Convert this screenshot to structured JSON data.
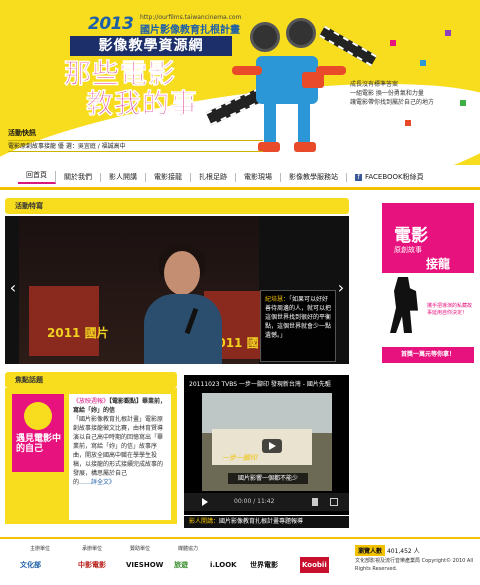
{
  "header": {
    "year": "2013",
    "url": "http://ourfilms.taiwancinema.com",
    "plan": "國片影像教育扎根計畫",
    "site_name": "影像教學資源網",
    "big_title_line1": "那些電影",
    "big_title_line2": "教我的事",
    "slogan": [
      "成長沒有標準答案",
      "一組電影 換一份勇氣和力量",
      "讓電影帶你找到屬於自己的地方"
    ],
    "news_label": "活動快訊",
    "news_text": "電影原創故事接龍 優 選：吳宜庭 / 福誠高中"
  },
  "nav": {
    "items": [
      "回首頁",
      "關於我們",
      "影人開講",
      "電影接龍",
      "扎根足跡",
      "電影現場",
      "影像教學服務站",
      "FACEBOOK粉絲頁"
    ]
  },
  "feature": {
    "heading": "活動特寫",
    "banner_left": "2011 國片",
    "banner_right": "2011 國片",
    "caption_name": "紀培慧：",
    "caption_text": "「如果可以好好善待周邊的人，就可以把這個世界找到很好的平衡點，這個世界就會少一點遺憾。」",
    "prev_label": "‹",
    "next_label": "›"
  },
  "ad": {
    "title_main": "電影",
    "title_sub": "原創故事",
    "title_emph": "接龍",
    "small_text": "攜手把導演的私藏故事延用自你決定！",
    "bottom_text": "首獎一萬元等你拿！"
  },
  "spotlight": {
    "heading": "焦點話題",
    "poster_text": "遇見電影中的自己",
    "link_title": "《放映週報》",
    "category": "【電影觀點】",
    "headline": "畢業前，寫給「妳」的信",
    "body": "「國片影像教育扎根計畫」電影原創故事接龍徵文比賽，由林育賢導演以自己高中時期的回憶寫出「畢業前，寫給「妳」的信」故事序曲，開放全國高中職在學學生投稿，以接龍的形式接續完成故事的發展，構思屬於自己的",
    "more": "……詳全文》"
  },
  "video": {
    "title": "20111023 TVBS 一步一腳印 發現新台灣 - 國片先驅",
    "tv_caption": "國片影響一個都不能少",
    "time": "00:00 / 11:42",
    "logo_text": "一步一腳印",
    "caption_label": "影人開講：",
    "caption_text": "國片影像教育扎根計畫專題報導"
  },
  "footer": {
    "labels": [
      "主辦單位",
      "承辦單位",
      "贊助單位",
      "媒體協力"
    ],
    "logos": [
      "文化部",
      "中影電影",
      "VIESHOW",
      "旅遊",
      "i.LOOK",
      "世界電影",
      "Koobii"
    ],
    "counter_label": "瀏覽人數",
    "counter_value": "401,452 人",
    "copyright": "文化部影視及流行音樂產業局 Copyright© 2010 All Rights Reserved."
  }
}
